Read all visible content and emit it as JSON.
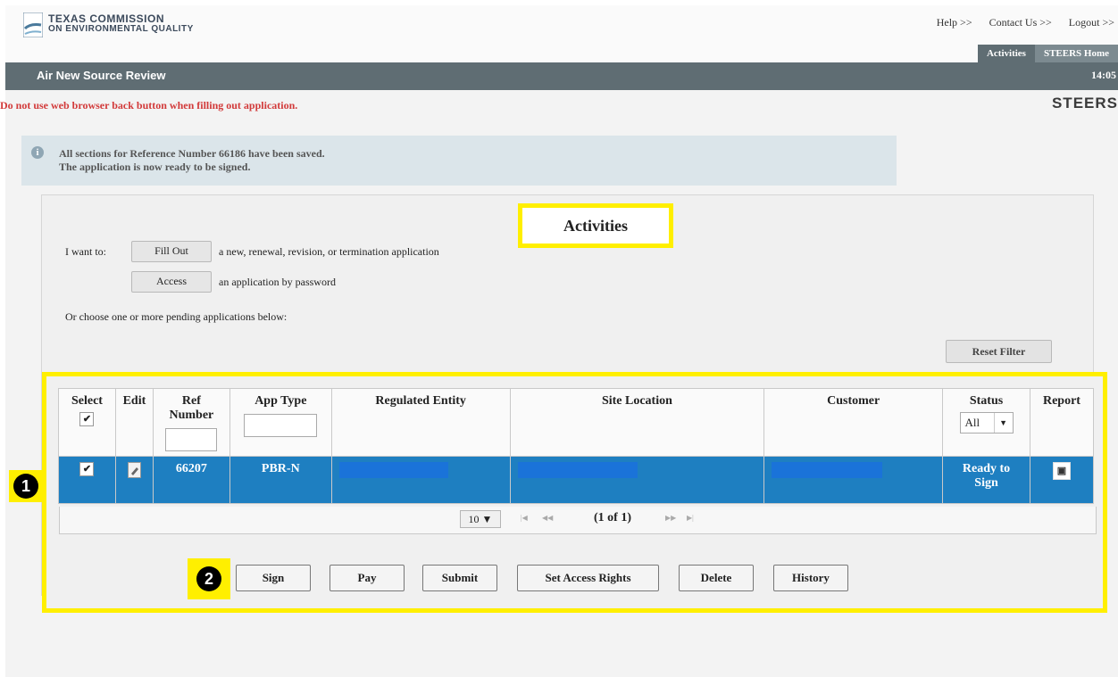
{
  "brand": {
    "line1": "TEXAS COMMISSION",
    "line2": "ON ENVIRONMENTAL QUALITY"
  },
  "top_links": {
    "help": "Help >>",
    "contact": "Contact Us >>",
    "logout": "Logout >>"
  },
  "tabs": {
    "activities": "Activities",
    "steers_home": "STEERS Home"
  },
  "title_bar": {
    "title": "Air New Source Review",
    "time": "14:05"
  },
  "warning": "Do not use web browser back button when filling out application.",
  "steers_logo": "STEERS",
  "info_message": {
    "line1": "All sections for Reference Number 66186 have been saved.",
    "line2": "The application is now ready to be signed."
  },
  "activities_title": "Activities",
  "i_want_to": "I want to:",
  "fill_out": {
    "label": "Fill Out",
    "description": "a new, renewal, revision, or termination application"
  },
  "access": {
    "label": "Access",
    "description": "an application by password"
  },
  "choose_text": "Or choose one or more pending applications below:",
  "reset_filter": "Reset Filter",
  "table": {
    "columns": {
      "select": "Select",
      "edit": "Edit",
      "ref_number": "Ref Number",
      "app_type": "App Type",
      "regulated_entity": "Regulated Entity",
      "site_location": "Site Location",
      "customer": "Customer",
      "status": "Status",
      "report": "Report"
    },
    "status_filter": "All",
    "rows": [
      {
        "ref_number": "66207",
        "app_type": "PBR-N",
        "status_line1": "Ready to",
        "status_line2": "Sign"
      }
    ]
  },
  "pager": {
    "page_size": "10 ▼",
    "page_info": "(1 of 1)"
  },
  "callouts": {
    "one": "1",
    "two": "2"
  },
  "actions": {
    "sign": "Sign",
    "pay": "Pay",
    "submit": "Submit",
    "set_access_rights": "Set Access Rights",
    "delete": "Delete",
    "history": "History"
  },
  "colors": {
    "accent_highlight": "#ffef00",
    "selected_row": "#1e7fc1",
    "header_bar": "#5f6d73",
    "warning": "#d23a3a"
  }
}
